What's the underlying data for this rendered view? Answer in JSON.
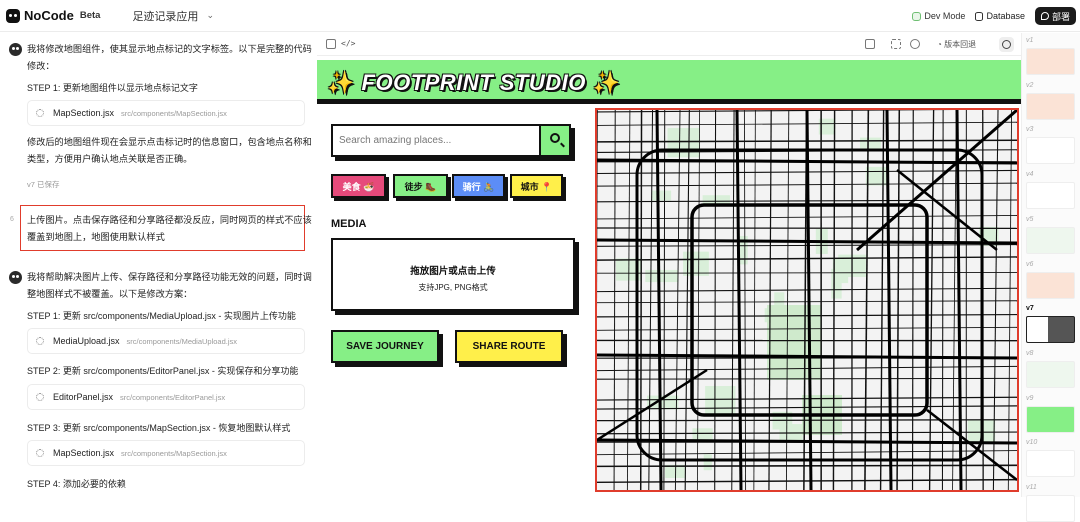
{
  "app": {
    "logo": "NoCode",
    "badge": "Beta",
    "project": "足迹记录应用"
  },
  "topbar": {
    "dev_mode": "Dev Mode",
    "database": "Database",
    "deploy": "部署"
  },
  "chat": {
    "m1_lines": [
      "我将修改地图组件，使其显示地点标记的文字标签。以下是完整的代码",
      "修改："
    ],
    "m1_step1": "STEP 1: 更新地图组件以显示地点标记文字",
    "m1_file": {
      "name": "MapSection.jsx",
      "path": "src/components/MapSection.jsx"
    },
    "m1_after_lines": [
      "修改后的地图组件现在会显示点击标记时的信息窗口，包含地点名称和",
      "类型，方便用户确认地点关联是否正确。"
    ],
    "m1_saved": "v7 已保存",
    "user_num": "6",
    "user_lines": [
      "上传图片。点击保存路径和分享路径都没反应，同时网页的样式不应该",
      "覆盖到地图上，地图使用默认样式"
    ],
    "m2_lines": [
      "我将帮助解决图片上传、保存路径和分享路径功能无效的问题，同时调",
      "整地图样式不被覆盖。以下是修改方案："
    ],
    "steps": [
      {
        "label": "STEP 1: 更新 src/components/MediaUpload.jsx - 实现图片上传功能",
        "name": "MediaUpload.jsx",
        "path": "src/components/MediaUpload.jsx"
      },
      {
        "label": "STEP 2: 更新 src/components/EditorPanel.jsx - 实现保存和分享功能",
        "name": "EditorPanel.jsx",
        "path": "src/components/EditorPanel.jsx"
      },
      {
        "label": "STEP 3: 更新 src/components/MapSection.jsx - 恢复地图默认样式",
        "name": "MapSection.jsx",
        "path": "src/components/MapSection.jsx"
      }
    ],
    "step4": "STEP 4: 添加必要的依赖"
  },
  "preview_toolbar": {
    "code_icon": "</>",
    "version_back": "版本回退"
  },
  "preview": {
    "title": "FOOTPRINT STUDIO",
    "sparkle": "✨",
    "search_placeholder": "Search amazing places...",
    "tags": [
      {
        "label": "美食 🍜",
        "color": "#e64a7b"
      },
      {
        "label": "徒步 🥾",
        "color": "#86ef86"
      },
      {
        "label": "骑行 🚴",
        "color": "#5c8df6"
      },
      {
        "label": "城市 📍",
        "color": "#ffef4a"
      }
    ],
    "media_label": "MEDIA",
    "upload_main": "拖放图片或点击上传",
    "upload_sub": "支持JPG, PNG格式",
    "save_button": "SAVE JOURNEY",
    "share_button": "SHARE ROUTE",
    "save_color": "#86ef86",
    "share_color": "#ffef4a"
  },
  "versions": [
    "v1",
    "v2",
    "v3",
    "v4",
    "v5",
    "v6",
    "v7",
    "v8",
    "v9",
    "v10",
    "v11"
  ],
  "active_version": "v7"
}
